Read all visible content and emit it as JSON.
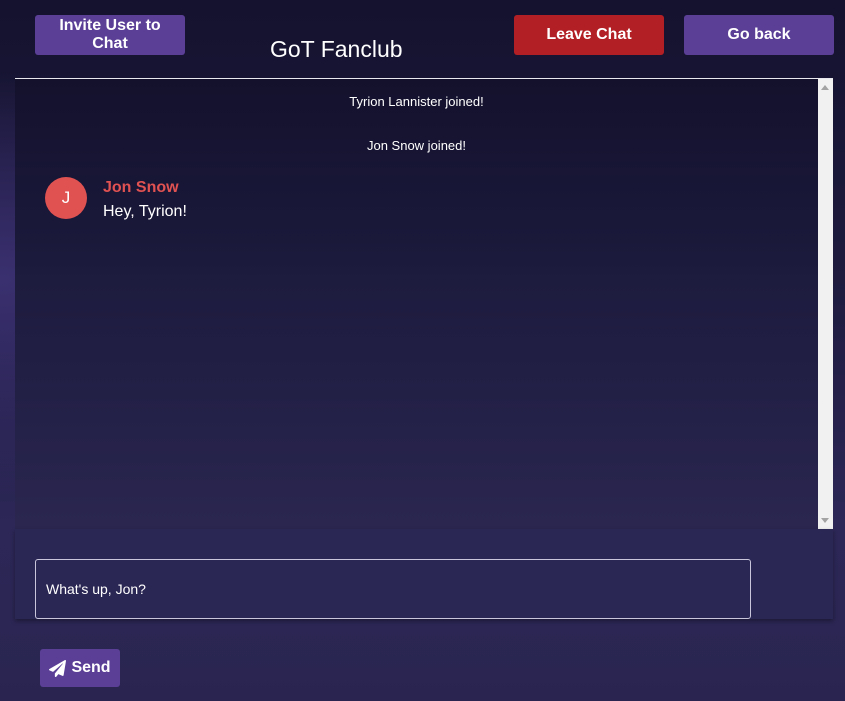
{
  "header": {
    "invite_label": "Invite User to Chat",
    "title": "GoT Fanclub",
    "leave_label": "Leave Chat",
    "back_label": "Go back"
  },
  "chat": {
    "system_messages": [
      "Tyrion Lannister joined!",
      "Jon Snow joined!"
    ],
    "messages": [
      {
        "avatar_initial": "J",
        "sender": "Jon Snow",
        "text": "Hey, Tyrion!",
        "color": "#e05252"
      }
    ]
  },
  "composer": {
    "input_value": "What's up, Jon?",
    "send_label": "Send",
    "send_icon": "paper-plane-icon"
  },
  "colors": {
    "primary_button": "#5b3f97",
    "danger_button": "#b21f24",
    "accent": "#e05252"
  }
}
